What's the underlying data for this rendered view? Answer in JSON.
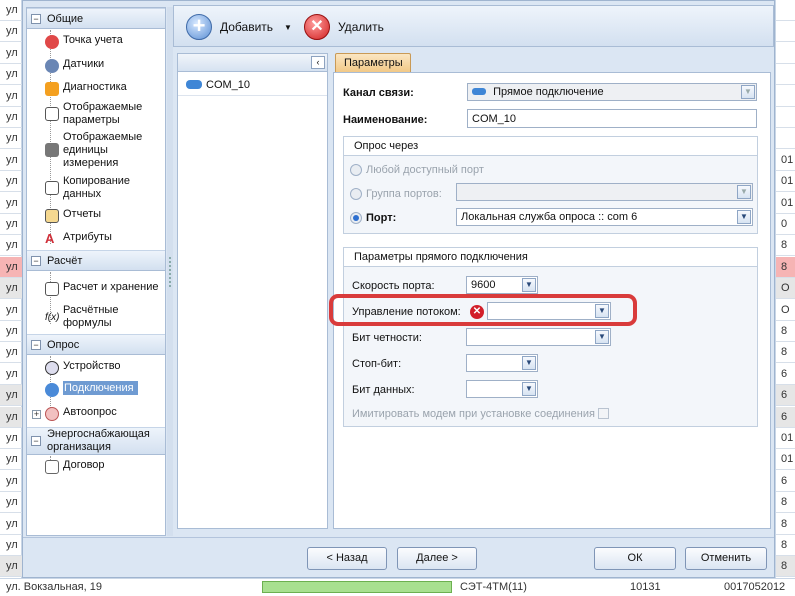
{
  "background": {
    "left_cells": [
      "ул",
      "ул",
      "ул",
      "ул",
      "ул",
      "ул",
      "ул",
      "ул",
      "ул",
      "ул",
      "ул",
      "ул",
      "ул",
      "ул",
      "ул",
      "ул",
      "ул",
      "ул",
      "ул",
      "ул",
      "ул",
      "ул",
      "ул",
      "ул",
      "ул",
      "ул",
      "ул"
    ],
    "right_cells": [
      "",
      "",
      "",
      "",
      "",
      "",
      "",
      "01",
      "01",
      "01",
      "0",
      "8",
      "8",
      "О",
      "О",
      "8",
      "8",
      "6",
      "6",
      "6",
      "01",
      "01",
      "6",
      "8",
      "8",
      "8",
      "8"
    ],
    "bottom_row": {
      "street": "ул. Вокзальная, 19",
      "device": "СЭТ-4ТМ(11)",
      "num1": "10131",
      "num2": "0017052012"
    }
  },
  "nav": {
    "groups": [
      {
        "label": "Общие",
        "items": [
          {
            "label": "Точка учета",
            "icon": "point-icon"
          },
          {
            "label": "Датчики",
            "icon": "sensor-icon"
          },
          {
            "label": "Диагностика",
            "icon": "diagnostics-icon"
          },
          {
            "label": "Отображаемые параметры",
            "icon": "params-icon"
          },
          {
            "label": "Отображаемые единицы измерения",
            "icon": "units-icon"
          },
          {
            "label": "Копирование данных",
            "icon": "copy-icon"
          },
          {
            "label": "Отчеты",
            "icon": "reports-icon"
          },
          {
            "label": "Атрибуты",
            "icon": "attributes-icon"
          }
        ]
      },
      {
        "label": "Расчёт",
        "items": [
          {
            "label": "Расчет и хранение",
            "icon": "calc-icon"
          },
          {
            "label": "Расчётные формулы",
            "icon": "formula-icon"
          }
        ]
      },
      {
        "label": "Опрос",
        "items": [
          {
            "label": "Устройство",
            "icon": "device-icon"
          },
          {
            "label": "Подключения",
            "icon": "connections-icon"
          },
          {
            "label": "Автоопрос",
            "icon": "autopoll-icon"
          }
        ]
      },
      {
        "label": "Энергоснабжающая организация",
        "items": [
          {
            "label": "Договор",
            "icon": "contract-icon"
          }
        ]
      }
    ],
    "selected": "Подключения"
  },
  "toolbar": {
    "add_label": "Добавить",
    "delete_label": "Удалить"
  },
  "list": {
    "items": [
      "COM_10"
    ]
  },
  "tab": {
    "label": "Параметры"
  },
  "form": {
    "channel_label": "Канал связи:",
    "channel_value": "Прямое подключение",
    "name_label": "Наименование:",
    "name_value": "COM_10",
    "poll_via": {
      "title": "Опрос через",
      "any_port": "Любой доступный порт",
      "port_group": "Группа портов:",
      "port_label": "Порт:",
      "port_value": "Локальная служба опроса :: com 6",
      "selected": "port"
    },
    "direct": {
      "title": "Параметры прямого подключения",
      "speed_label": "Скорость порта:",
      "speed_value": "9600",
      "flow_label": "Управление потоком:",
      "flow_value": "",
      "parity_label": "Бит четности:",
      "parity_value": "",
      "stop_label": "Стоп-бит:",
      "stop_value": "",
      "data_label": "Бит данных:",
      "data_value": "",
      "modem_label": "Имитировать модем при установке соединения",
      "modem_checked": false
    }
  },
  "footer": {
    "back": "< Назад",
    "next": "Далее >",
    "ok": "ОК",
    "cancel": "Отменить"
  },
  "colors": {
    "highlight": "#d93b3b",
    "selected": "#6f9bd2",
    "tab": "#f2c987"
  }
}
